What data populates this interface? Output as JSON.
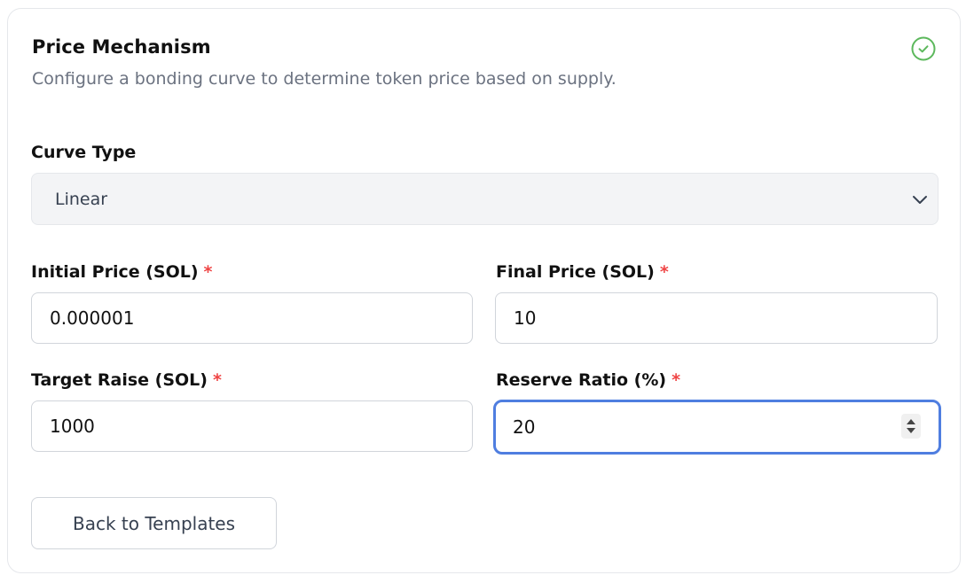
{
  "section": {
    "title": "Price Mechanism",
    "subtitle": "Configure a bonding curve to determine token price based on supply.",
    "status_icon": "check-circle-icon",
    "status_color": "#5cb85c"
  },
  "curve_type": {
    "label": "Curve Type",
    "selected": "Linear",
    "icon": "chevron-down-icon"
  },
  "fields": {
    "initial_price": {
      "label": "Initial Price (SOL)",
      "required_mark": "*",
      "value": "0.000001"
    },
    "final_price": {
      "label": "Final Price (SOL)",
      "required_mark": "*",
      "value": "10"
    },
    "target_raise": {
      "label": "Target Raise (SOL)",
      "required_mark": "*",
      "value": "1000"
    },
    "reserve_ratio": {
      "label": "Reserve Ratio (%)",
      "required_mark": "*",
      "value": "20"
    }
  },
  "actions": {
    "back_label": "Back to Templates"
  },
  "colors": {
    "required": "#ef4444",
    "focus_ring": "#4f7ee0"
  }
}
